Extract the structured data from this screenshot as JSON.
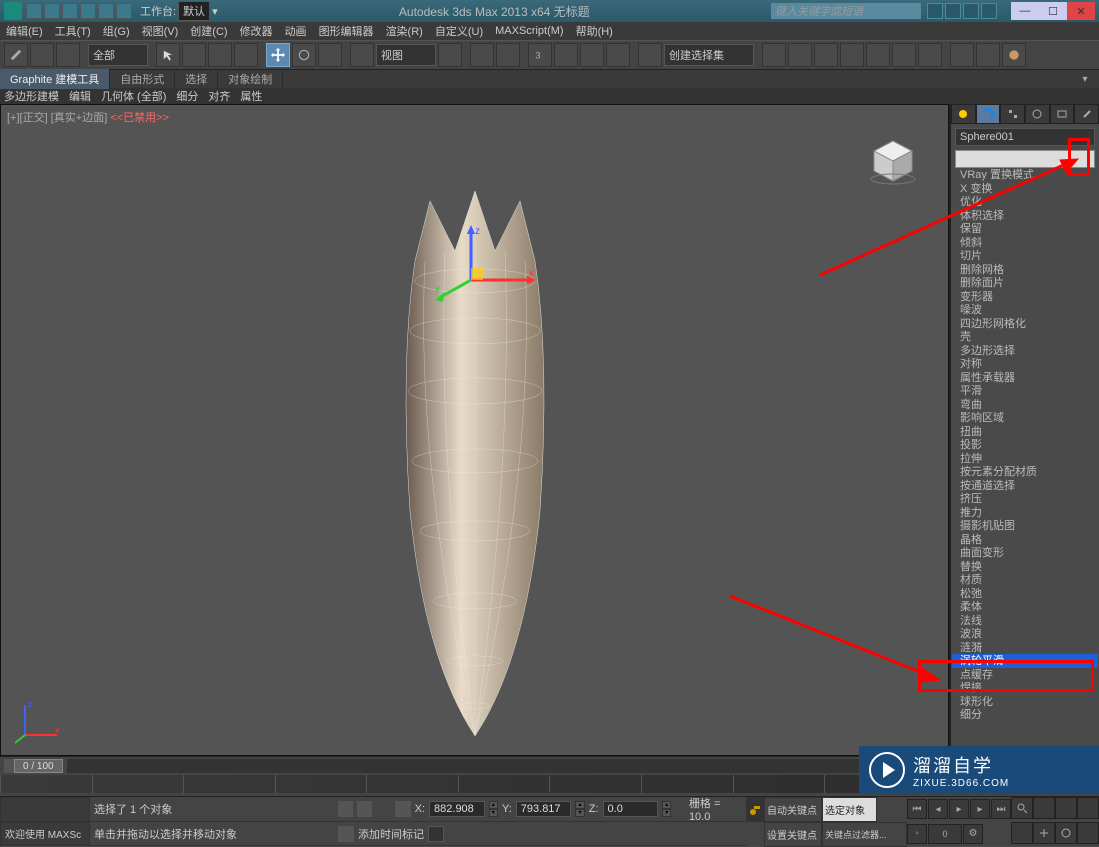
{
  "titlebar": {
    "workspace_label": "工作台:",
    "workspace_value": "默认",
    "app_title": "Autodesk 3ds Max  2013 x64    无标题",
    "search_placeholder": "键入关键字或短语"
  },
  "menubar": [
    "编辑(E)",
    "工具(T)",
    "组(G)",
    "视图(V)",
    "创建(C)",
    "修改器",
    "动画",
    "图形编辑器",
    "渲染(R)",
    "自定义(U)",
    "MAXScript(M)",
    "帮助(H)"
  ],
  "toolbar": {
    "select_set_placeholder": "创建选择集",
    "sys_dropdown": "全部",
    "view_dropdown": "视图"
  },
  "ribbon_tabs": [
    "Graphite 建模工具",
    "自由形式",
    "选择",
    "对象绘制"
  ],
  "ribbon2": [
    "多边形建模",
    "编辑",
    "几何体 (全部)",
    "细分",
    "对齐",
    "属性"
  ],
  "viewport": {
    "label_prefix": "[+][正交]",
    "label_mode": "[真实+边面]",
    "disabled_tag": "<<已禁用>>"
  },
  "cmd_panel": {
    "object_name": "Sphere001",
    "modifiers": [
      "VRay 置换模式",
      "X 变换",
      "优化",
      "体积选择",
      "保留",
      "倾斜",
      "切片",
      "删除网格",
      "删除面片",
      "变形器",
      "噪波",
      "四边形网格化",
      "壳",
      "多边形选择",
      "对称",
      "属性承载器",
      "平滑",
      "弯曲",
      "影响区域",
      "扭曲",
      "投影",
      "拉伸",
      "按元素分配材质",
      "按通道选择",
      "挤压",
      "推力",
      "摄影机贴图",
      "晶格",
      "曲面变形",
      "替换",
      "材质",
      "松弛",
      "柔体",
      "法线",
      "波浪",
      "涟漪",
      "涡轮平滑",
      "点缓存",
      "焊接",
      "球形化",
      "细分"
    ],
    "selected_modifier_index": 36
  },
  "timeline": {
    "slider_label": "0 / 100"
  },
  "statusbar": {
    "welcome": "欢迎使用  MAXSc",
    "selection_text": "选择了 1 个对象",
    "prompt_text": "单击并拖动以选择并移动对象",
    "add_time_tag": "添加时间标记",
    "x_val": "882.908",
    "y_val": "793.817",
    "z_val": "0.0",
    "grid_label": "栅格 = 10.0",
    "auto_key": "自动关键点",
    "set_key": "设置关键点",
    "selected_obj": "选定对象",
    "key_filter": "关键点过滤器..."
  },
  "watermark": {
    "cn": "溜溜自学",
    "en": "ZIXUE.3D66.COM"
  },
  "window_controls": {
    "min": "—",
    "max": "☐",
    "close": "✕"
  }
}
